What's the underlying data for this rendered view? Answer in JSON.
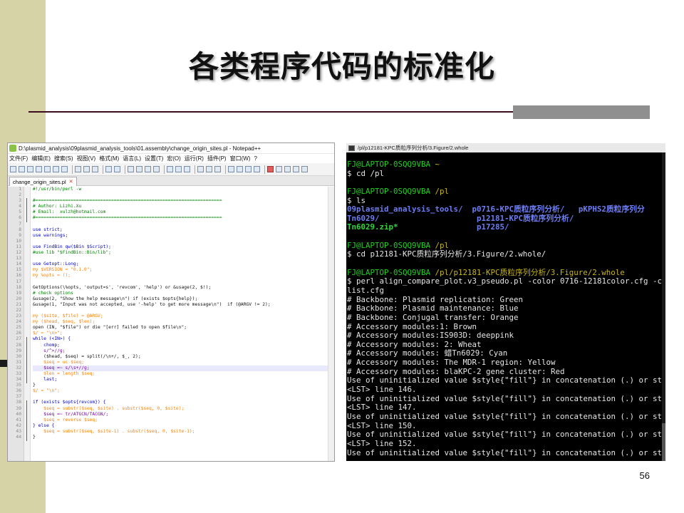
{
  "slide": {
    "title": "各类程序代码的标准化",
    "page_number": "56"
  },
  "notepad": {
    "title": "D:\\plasmid_analysis\\09plasmid_analysis_tools\\01.assembly\\change_origin_sites.pl - Notepad++",
    "menu": [
      "文件(F)",
      "编辑(E)",
      "搜索(S)",
      "视图(V)",
      "格式(M)",
      "语言(L)",
      "设置(T)",
      "宏(O)",
      "运行(R)",
      "插件(P)",
      "窗口(W)",
      "?"
    ],
    "tab_label": "change_origin_sites.pl",
    "tab_close": "✕",
    "lines": [
      {
        "n": "1",
        "t": "#!/usr/bin/perl -w",
        "c": "c-com"
      },
      {
        "n": "2",
        "t": "",
        "c": "c-def"
      },
      {
        "n": "3",
        "t": "#=====================================================================",
        "c": "c-com"
      },
      {
        "n": "4",
        "t": "# Author: Lizhi.Xu",
        "c": "c-com"
      },
      {
        "n": "5",
        "t": "# Email:  xulzh@hotmail.com",
        "c": "c-com"
      },
      {
        "n": "6",
        "t": "#=====================================================================",
        "c": "c-com"
      },
      {
        "n": "7",
        "t": "",
        "c": "c-def"
      },
      {
        "n": "8",
        "t": "use strict;",
        "c": "c-kw"
      },
      {
        "n": "9",
        "t": "use warnings;",
        "c": "c-kw"
      },
      {
        "n": "10",
        "t": "",
        "c": "c-def"
      },
      {
        "n": "11",
        "t": "use FindBin qw($Bin $Script);",
        "c": "c-kw"
      },
      {
        "n": "12",
        "t": "#use lib \"$FindBin::Bin/lib\";",
        "c": "c-com"
      },
      {
        "n": "13",
        "t": "",
        "c": "c-def"
      },
      {
        "n": "14",
        "t": "use Getopt::Long;",
        "c": "c-kw"
      },
      {
        "n": "15",
        "t": "my $VERSION = \"0.1.0\";",
        "c": "c-var"
      },
      {
        "n": "16",
        "t": "my %opts = ();",
        "c": "c-var"
      },
      {
        "n": "17",
        "t": "",
        "c": "c-def"
      },
      {
        "n": "18",
        "t": "GetOptions(\\%opts, 'output=s', 'revcom', 'help') or &usage(2, $!);",
        "c": "c-def"
      },
      {
        "n": "19",
        "t": "# check options",
        "c": "c-com"
      },
      {
        "n": "20",
        "t": "&usage(2, \"Show the help message\\n\") if (exists $opts{help});",
        "c": "c-def"
      },
      {
        "n": "21",
        "t": "&usage(1, \"Input was not accepted, use '-help' to get more message\\n\")  if (@ARGV != 2);",
        "c": "c-def"
      },
      {
        "n": "22",
        "t": "",
        "c": "c-def"
      },
      {
        "n": "23",
        "t": "my ($site, $file) = @ARGV;",
        "c": "c-var"
      },
      {
        "n": "24",
        "t": "my ($head, $seq, $len);",
        "c": "c-var"
      },
      {
        "n": "25",
        "t": "open (IN, \"$file\") or die \"[err] failed to open $file\\n\";",
        "c": "c-def"
      },
      {
        "n": "26",
        "t": "$/ = \"\\n>\";",
        "c": "c-var"
      },
      {
        "n": "27",
        "t": "while (<IN>) {",
        "c": "c-kw"
      },
      {
        "n": "28",
        "t": "    chomp;",
        "c": "c-kw"
      },
      {
        "n": "29",
        "t": "    s/^>//g;",
        "c": "c-reg"
      },
      {
        "n": "30",
        "t": "    ($head, $seq) = split(/\\n+/, $_, 2);",
        "c": "c-def"
      },
      {
        "n": "31",
        "t": "    $seq = uc $seq;",
        "c": "c-var"
      },
      {
        "n": "32",
        "t": "    $seq =~ s/\\s+//g;",
        "c": "c-reg"
      },
      {
        "n": "33",
        "t": "    $len = length $seq;",
        "c": "c-var"
      },
      {
        "n": "34",
        "t": "    last;",
        "c": "c-kw"
      },
      {
        "n": "35",
        "t": "}",
        "c": "c-def"
      },
      {
        "n": "36",
        "t": "$/ = \"\\n\";",
        "c": "c-var"
      },
      {
        "n": "37",
        "t": "",
        "c": "c-def"
      },
      {
        "n": "38",
        "t": "if (exists $opts{revcom}) {",
        "c": "c-kw"
      },
      {
        "n": "39",
        "t": "    $seq = substr($seq, $site) . substr($seq, 0, $site);",
        "c": "c-var"
      },
      {
        "n": "40",
        "t": "    $seq =~ tr/ATGCN/TACGN/;",
        "c": "c-reg"
      },
      {
        "n": "41",
        "t": "    $seq = reverse $seq;",
        "c": "c-var"
      },
      {
        "n": "42",
        "t": "} else {",
        "c": "c-kw"
      },
      {
        "n": "43",
        "t": "    $seq = substr($seq, $site-1) . substr($seq, 0, $site-1);",
        "c": "c-var"
      },
      {
        "n": "44",
        "t": "}",
        "c": "c-def"
      }
    ]
  },
  "terminal": {
    "title": "/pl/p12181-KPC质粒序列分析/3.Figure/2.whole",
    "lines": [
      [
        [
          "FJ@LAPTOP-0SQQ9VBA",
          "t-green"
        ],
        [
          " ~",
          "t-yellow"
        ]
      ],
      [
        [
          "$ cd /pl",
          "t-white"
        ]
      ],
      [
        [
          "",
          "t-white"
        ]
      ],
      [
        [
          "FJ@LAPTOP-0SQQ9VBA",
          "t-green"
        ],
        [
          " /pl",
          "t-yellow"
        ]
      ],
      [
        [
          "$ ls",
          "t-white"
        ]
      ],
      [
        [
          "09plasmid_analysis_tools/",
          "t-blue"
        ],
        [
          "  ",
          "t-white"
        ],
        [
          "p0716-KPC质粒序列分析/",
          "t-blue"
        ],
        [
          "   ",
          "t-white"
        ],
        [
          "pKPHS2质粒序列分",
          "t-blue"
        ]
      ],
      [
        [
          "Tn6029/",
          "t-blue"
        ],
        [
          "                     ",
          "t-white"
        ],
        [
          "p12181-KPC质粒序列分析/",
          "t-blue"
        ]
      ],
      [
        [
          "Tn6029.zip*",
          "t-cyanb"
        ],
        [
          "                 ",
          "t-white"
        ],
        [
          "p17285/",
          "t-blue"
        ]
      ],
      [
        [
          "",
          "t-white"
        ]
      ],
      [
        [
          "FJ@LAPTOP-0SQQ9VBA",
          "t-green"
        ],
        [
          " /pl",
          "t-yellow"
        ]
      ],
      [
        [
          "$ cd p12181-KPC质粒序列分析/3.Figure/2.whole/",
          "t-white"
        ]
      ],
      [
        [
          "",
          "t-white"
        ]
      ],
      [
        [
          "FJ@LAPTOP-0SQQ9VBA",
          "t-green"
        ],
        [
          " /pl/p12181-KPC质粒序列分析/3.Figure/2.whole",
          "t-yellow"
        ]
      ],
      [
        [
          "$ perl align_compare_plot.v3_pseudo.pl -color 0716-12181color.cfg -c",
          "t-white"
        ]
      ],
      [
        [
          "list.cfg",
          "t-white"
        ]
      ],
      [
        [
          "# Backbone: Plasmid replication: Green",
          "t-white"
        ]
      ],
      [
        [
          "# Backbone: Plasmid maintenance: Blue",
          "t-white"
        ]
      ],
      [
        [
          "# Backbone: Conjugal transfer: Orange",
          "t-white"
        ]
      ],
      [
        [
          "# Accessory modules:1: Brown",
          "t-white"
        ]
      ],
      [
        [
          "# Accessory modules:IS903D: deeppink",
          "t-white"
        ]
      ],
      [
        [
          "# Accessory modules: 2: Wheat",
          "t-white"
        ]
      ],
      [
        [
          "# Accessory modules: 蜡Tn6029: Cyan",
          "t-white"
        ]
      ],
      [
        [
          "# Accessory modules: The MDR-1 region: Yellow",
          "t-white"
        ]
      ],
      [
        [
          "# Accessory modules: blaKPC-2 gene cluster: Red",
          "t-white"
        ]
      ],
      [
        [
          "Use of uninitialized value $style{\"fill\"} in concatenation (.) or st",
          "t-white"
        ]
      ],
      [
        [
          "<LST> line 146.",
          "t-white"
        ]
      ],
      [
        [
          "Use of uninitialized value $style{\"fill\"} in concatenation (.) or st",
          "t-white"
        ]
      ],
      [
        [
          "<LST> line 147.",
          "t-white"
        ]
      ],
      [
        [
          "Use of uninitialized value $style{\"fill\"} in concatenation (.) or st",
          "t-white"
        ]
      ],
      [
        [
          "<LST> line 150.",
          "t-white"
        ]
      ],
      [
        [
          "Use of uninitialized value $style{\"fill\"} in concatenation (.) or st",
          "t-white"
        ]
      ],
      [
        [
          "<LST> line 152.",
          "t-white"
        ]
      ],
      [
        [
          "Use of uninitialized value $style{\"fill\"} in concatenation (.) or st",
          "t-white"
        ]
      ]
    ]
  }
}
